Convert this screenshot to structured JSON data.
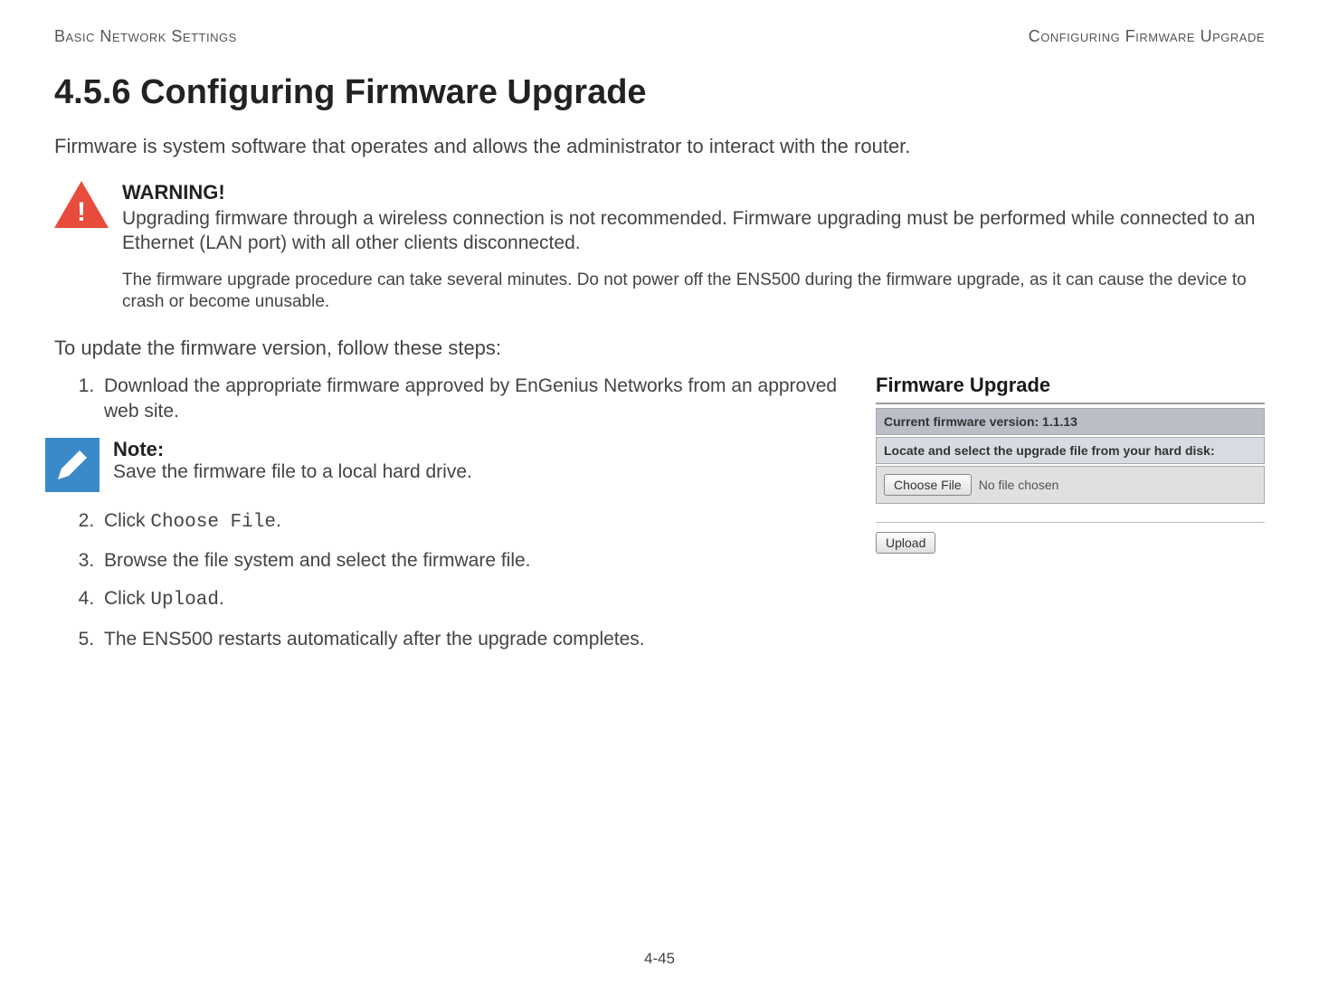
{
  "header": {
    "left": "Basic Network Settings",
    "right": "Configuring Firmware Upgrade"
  },
  "title": "4.5.6 Configuring Firmware Upgrade",
  "intro": "Firmware is system software that operates and allows the administrator to interact with the router.",
  "warning": {
    "title": "WARNING!",
    "text": "Upgrading firmware through a wireless connection is not recommended. Firmware upgrading must be performed while connected to an Ethernet (LAN port) with all other clients disconnected.",
    "sub": "The firmware upgrade procedure can take several minutes. Do not power off the ENS500 during the firmware upgrade, as it can cause the device to crash or become unusable."
  },
  "lead": "To update the firmware version, follow these steps:",
  "steps": {
    "s1": "Download the appropriate firmware approved by EnGenius Networks from an approved web site.",
    "s2_pre": "Click ",
    "s2_mono": "Choose File",
    "s2_post": ".",
    "s3": "Browse the file system and select the firmware file.",
    "s4_pre": "Click ",
    "s4_mono": "Upload",
    "s4_post": ".",
    "s5": "The ENS500 restarts automatically after the upgrade completes."
  },
  "note": {
    "title": "Note:",
    "text": "Save the firmware file to a local hard drive."
  },
  "screenshot": {
    "title": "Firmware Upgrade",
    "version_row": "Current firmware version: 1.1.13",
    "locate_row": "Locate and select the upgrade file from your hard disk:",
    "choose_btn": "Choose File",
    "no_file": "No file chosen",
    "upload_btn": "Upload"
  },
  "page_number": "4-45"
}
